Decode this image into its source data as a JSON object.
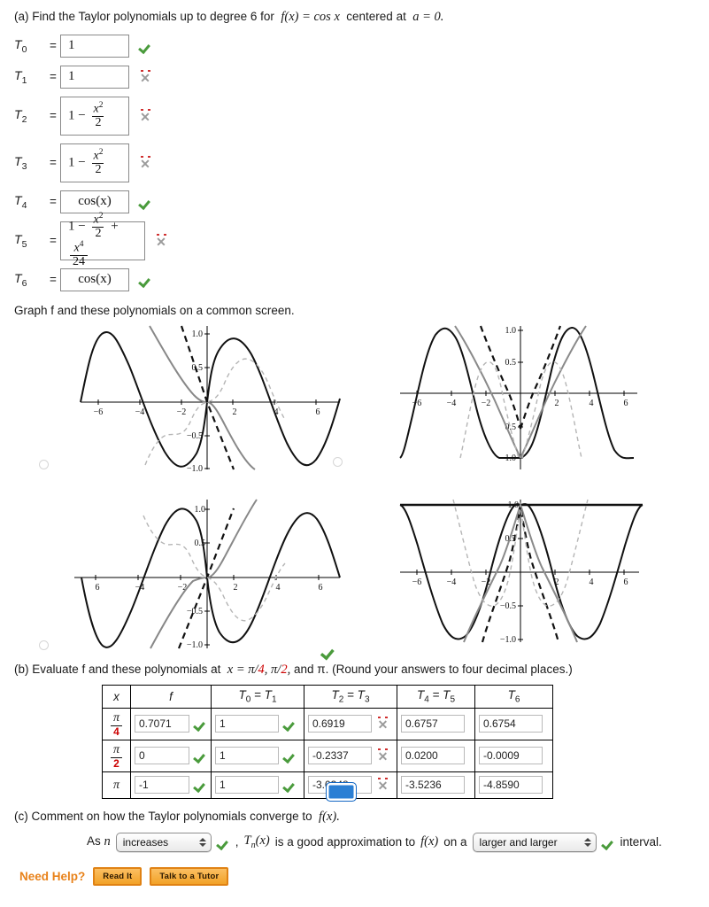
{
  "part_a": {
    "prompt_prefix": "(a) Find the Taylor polynomials up to degree 6 for",
    "prompt_fx": "f(x) = cos x",
    "prompt_mid": "centered at",
    "prompt_center": "a = 0.",
    "eq": "=",
    "rows": [
      {
        "label": "T",
        "sub": "0",
        "value_text": "1",
        "kind": "plain",
        "status": "correct"
      },
      {
        "label": "T",
        "sub": "1",
        "value_text": "1",
        "kind": "plain",
        "status": "incorrect"
      },
      {
        "label": "T",
        "sub": "2",
        "value_text": "1 - x^2/2",
        "kind": "frac1",
        "status": "incorrect"
      },
      {
        "label": "T",
        "sub": "3",
        "value_text": "1 - x^2/2",
        "kind": "frac1",
        "status": "incorrect"
      },
      {
        "label": "T",
        "sub": "4",
        "value_text": "cos(x)",
        "kind": "cos",
        "status": "correct"
      },
      {
        "label": "T",
        "sub": "5",
        "value_text": "1 - x^2/2 + x^4/24",
        "kind": "frac2",
        "status": "incorrect"
      },
      {
        "label": "T",
        "sub": "6",
        "value_text": "cos(x)",
        "kind": "cos",
        "status": "correct"
      }
    ],
    "frac_parts": {
      "one": "1",
      "minus": "−",
      "plus": "+",
      "x": "x",
      "exp2": "2",
      "exp4": "4",
      "den2": "2",
      "den24": "24",
      "cos": "cos(x)"
    }
  },
  "graphs": {
    "lead": "Graph f and these polynomials on a common screen.",
    "options": [
      {
        "id": "graph-option-1",
        "curve": "neg-sine",
        "selected": false,
        "correct_mark": false
      },
      {
        "id": "graph-option-2",
        "curve": "abs-cos",
        "selected": false,
        "correct_mark": false
      },
      {
        "id": "graph-option-3",
        "curve": "sine",
        "selected": false,
        "correct_mark": false
      },
      {
        "id": "graph-option-4",
        "curve": "cosine",
        "selected": true,
        "correct_mark": true
      }
    ],
    "x_ticks": [
      "−6",
      "−4",
      "−2",
      "2",
      "4",
      "6"
    ],
    "y_ticks_full": [
      "1.0",
      "0.5",
      "−0.5",
      "−1.0"
    ],
    "y_ticks_pos": [
      "1.0",
      "0.5",
      "−1.0"
    ],
    "xlim": [
      -6.4,
      6.4
    ],
    "ylim": [
      -1.05,
      1.05
    ]
  },
  "chart_data": {
    "type": "line",
    "title": "Graph f and these polynomials on a common screen.",
    "xlabel": "x",
    "ylabel": "",
    "xlim": [
      -6.4,
      6.4
    ],
    "ylim": [
      -1.05,
      1.05
    ],
    "xticks": [
      -6,
      -4,
      -2,
      2,
      4,
      6
    ],
    "yticks": [
      -1.0,
      -0.5,
      0.5,
      1.0
    ],
    "grid": false,
    "legend": "none",
    "panels": [
      {
        "panel": 1,
        "selected": false,
        "series": [
          {
            "name": "f (solid black)",
            "fn": "-sin(x)",
            "style": "solid-black"
          },
          {
            "name": "T2 = T3 (gray solid)",
            "fn": "-x + x^3/6",
            "style": "solid-gray"
          },
          {
            "name": "T0 = T1 (dashed black)",
            "fn": "-x",
            "style": "dashed-black"
          },
          {
            "name": "T4 = T5 (light dashed)",
            "fn": "-x + x^3/6 - x^5/120",
            "style": "dashed-light"
          }
        ]
      },
      {
        "panel": 2,
        "selected": false,
        "series": [
          {
            "name": "f (solid black)",
            "fn": "|cos(x)|",
            "style": "solid-black"
          },
          {
            "name": "gray solid",
            "fn": "1 - x^2/2 clipped",
            "style": "solid-gray"
          },
          {
            "name": "dashed black",
            "fn": "steep line",
            "style": "dashed-black"
          },
          {
            "name": "light dashed",
            "fn": "shifted hump",
            "style": "dashed-light"
          }
        ]
      },
      {
        "panel": 3,
        "selected": false,
        "series": [
          {
            "name": "f (solid black)",
            "fn": "sin(x)",
            "style": "solid-black"
          },
          {
            "name": "gray solid",
            "fn": "x - x^3/6",
            "style": "solid-gray"
          },
          {
            "name": "dashed black",
            "fn": "x",
            "style": "dashed-black"
          },
          {
            "name": "light dashed",
            "fn": "x - x^3/6 + x^5/120",
            "style": "dashed-light"
          }
        ]
      },
      {
        "panel": 4,
        "selected": true,
        "series": [
          {
            "name": "f (solid black)",
            "fn": "cos(x)",
            "style": "solid-black"
          },
          {
            "name": "T2 = T3 (gray solid)",
            "fn": "1 - x^2/2",
            "style": "solid-gray"
          },
          {
            "name": "T0 = T1 (dashed black)",
            "fn": "1",
            "style": "dashed-black"
          },
          {
            "name": "T4 = T5 (light dashed)",
            "fn": "1 - x^2/2 + x^4/24",
            "style": "dashed-light"
          }
        ]
      }
    ]
  },
  "part_b": {
    "lead_1": "(b) Evaluate f and these polynomials at",
    "lead_x": "x = π/",
    "lead_d1": "4",
    "lead_c1": ", π/",
    "lead_d2": "2",
    "lead_2": ", and π. (Round your answers to four decimal places.)",
    "headers": [
      "x",
      "f",
      "T0 = T1",
      "T2 = T3",
      "T4 = T5",
      "T6"
    ],
    "header_parts": [
      {
        "base": "x",
        "sub": ""
      },
      {
        "base": "f",
        "sub": ""
      },
      {
        "base": "T",
        "sub": "0",
        "eq": "=",
        "base2": "T",
        "sub2": "1"
      },
      {
        "base": "T",
        "sub": "2",
        "eq": "=",
        "base2": "T",
        "sub2": "3"
      },
      {
        "base": "T",
        "sub": "4",
        "eq": "=",
        "base2": "T",
        "sub2": "5"
      },
      {
        "base": "T",
        "sub": "6"
      }
    ],
    "rows": [
      {
        "x_num": "π",
        "x_den": "4",
        "f": {
          "value": "0.7071",
          "status": "correct"
        },
        "t01": {
          "value": "1",
          "status": "correct"
        },
        "t23": {
          "value": "0.6919",
          "status": "incorrect"
        },
        "t45": {
          "value": "0.6757",
          "status": "none"
        },
        "t6": {
          "value": "0.6754",
          "status": "none"
        }
      },
      {
        "x_num": "π",
        "x_den": "2",
        "f": {
          "value": "0",
          "status": "correct"
        },
        "t01": {
          "value": "1",
          "status": "correct"
        },
        "t23": {
          "value": "-0.2337",
          "status": "incorrect"
        },
        "t45": {
          "value": "0.0200",
          "status": "none"
        },
        "t6": {
          "value": "-0.0009",
          "status": "none"
        }
      },
      {
        "x_num": "π",
        "x_den": "",
        "f": {
          "value": "-1",
          "status": "correct"
        },
        "t01": {
          "value": "1",
          "status": "correct"
        },
        "t23": {
          "value": "-3.0348",
          "status": "incorrect"
        },
        "t45": {
          "value": "-3.5236",
          "status": "none"
        },
        "t6": {
          "value": "-4.8590",
          "status": "none"
        }
      }
    ]
  },
  "part_c": {
    "lead": "(c) Comment on how the Taylor polynomials converge to  f(x).",
    "as_n": "As n",
    "select_1_value": "increases",
    "mid_text": ",  Tn(x)  is a good approximation to  f(x)  on a",
    "mid_1": ",",
    "mid_tn": "T",
    "mid_tn_sub": "n",
    "mid_tn_x": "(x)",
    "mid_2": "is a good approximation to",
    "mid_fx": "f(x)",
    "mid_3": "on a",
    "select_2_value": "larger and larger",
    "tail_text": "interval.",
    "select_1_status": "correct",
    "select_2_status": "correct"
  },
  "footer": {
    "need_help": "Need Help?",
    "read_it": "Read It",
    "talk_tutor": "Talk to a Tutor"
  },
  "colors": {
    "correct_green": "#4a9b3c",
    "incorrect_gray": "#9b9b9b",
    "incorrect_red_dot": "#d03030",
    "radio_blue": "#2b7fd4",
    "accent_orange": "#e8821a",
    "red_text": "#cc0000"
  }
}
